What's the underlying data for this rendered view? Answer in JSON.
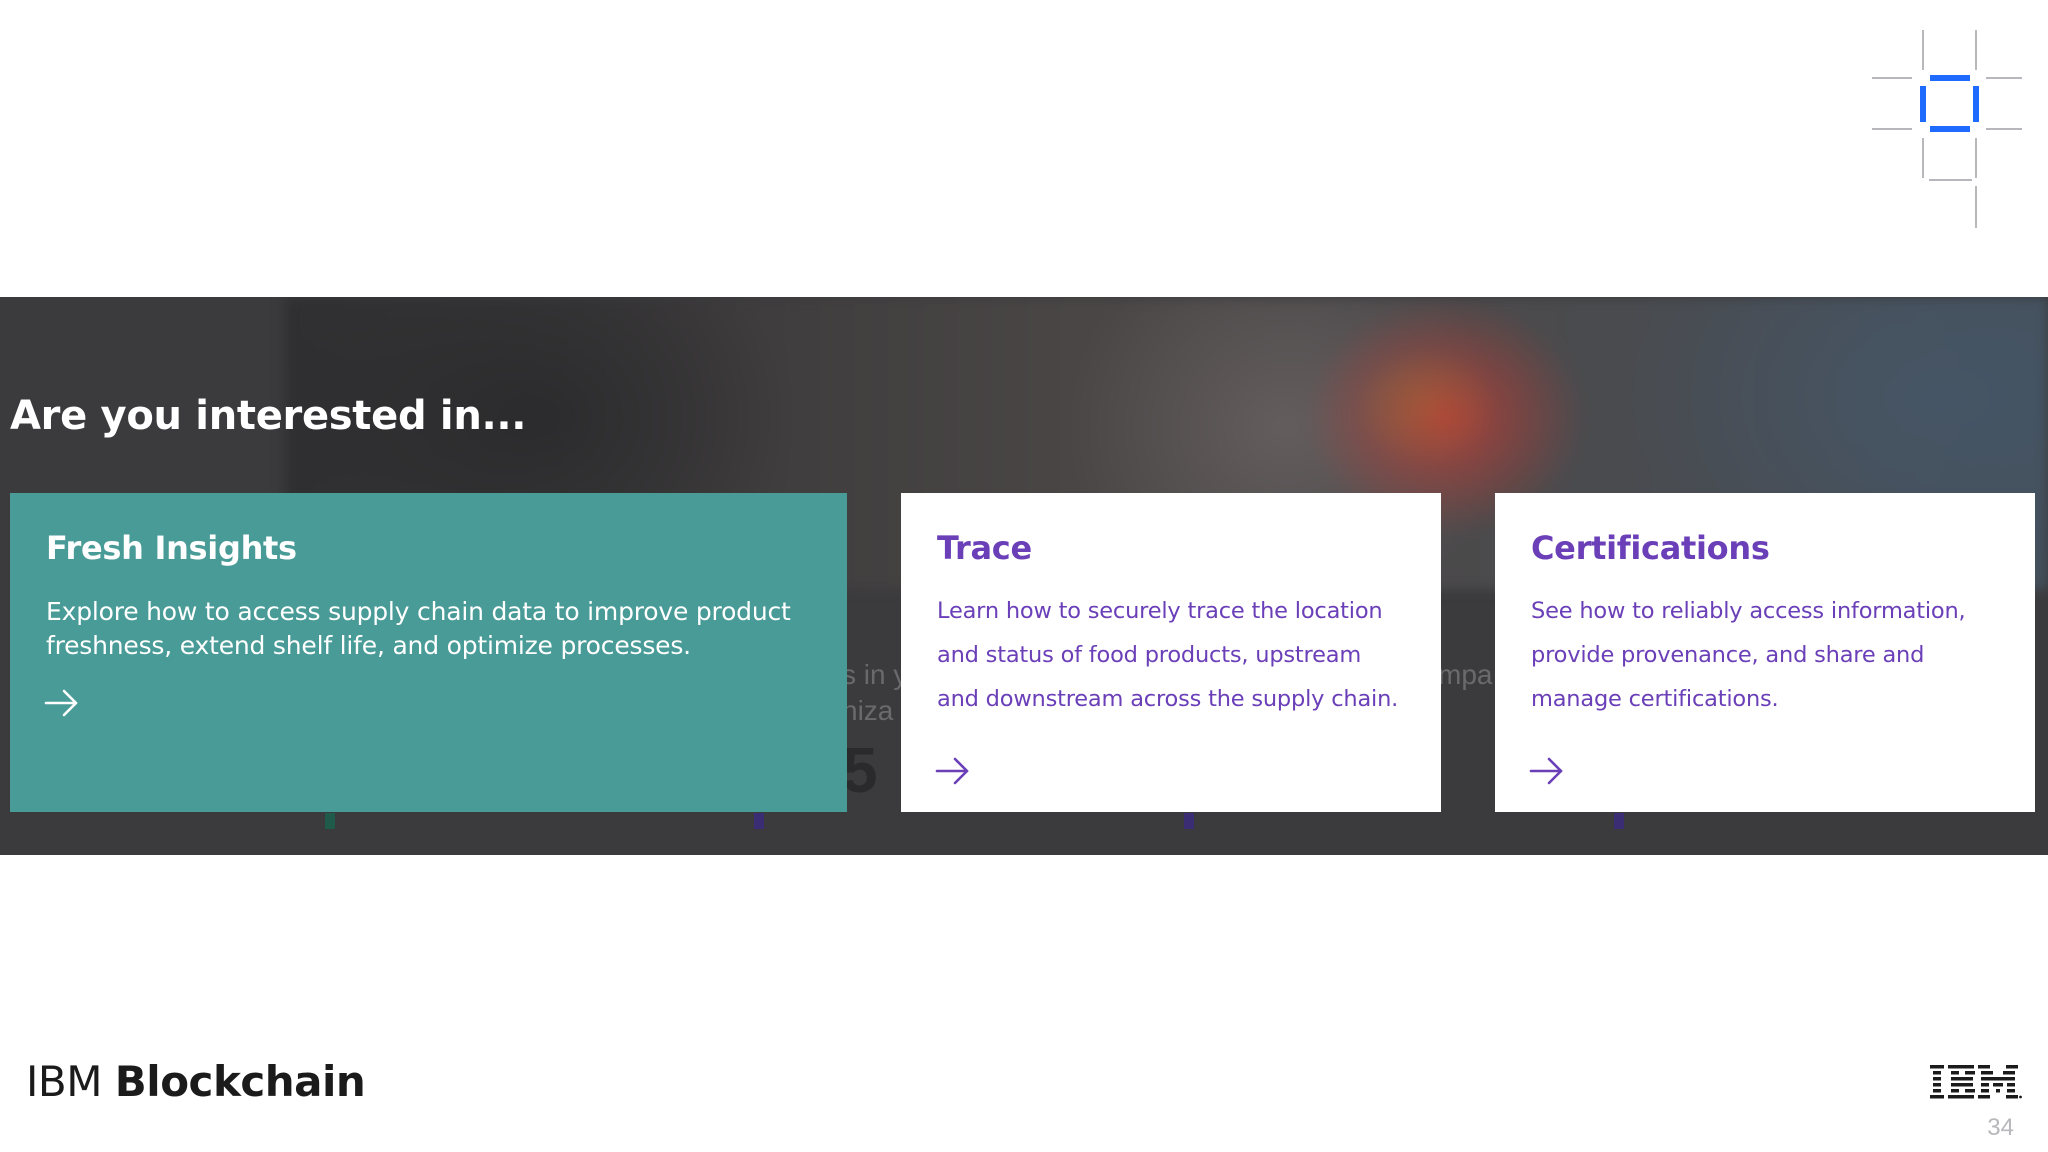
{
  "section": {
    "heading": "Are you interested in..."
  },
  "cards": [
    {
      "title": "Fresh Insights",
      "description": "Explore how to access supply chain data to improve product freshness, extend shelf life, and optimize processes.",
      "icon": "arrow-right-icon"
    },
    {
      "title": "Trace",
      "description": "Learn how to securely trace the location and status of food products, upstream and downstream across the supply chain.",
      "icon": "arrow-right-icon"
    },
    {
      "title": "Certifications",
      "description": "See how to reliably access information, provide provenance, and share and manage certifications.",
      "icon": "arrow-right-icon"
    }
  ],
  "background_fragments": [
    "s in y",
    "niza",
    "5",
    "mpa"
  ],
  "footer": {
    "brand_prefix": "IBM",
    "brand_product": "Blockchain",
    "logo": "ibm-logo",
    "page_number": "34"
  },
  "colors": {
    "teal_card": "#499b97",
    "purple_text": "#6a3fb8",
    "band_background": "#3b3b3d",
    "logo_blue": "#1f6bff"
  },
  "icons": {
    "top_right": "grid-square-logo-icon"
  }
}
